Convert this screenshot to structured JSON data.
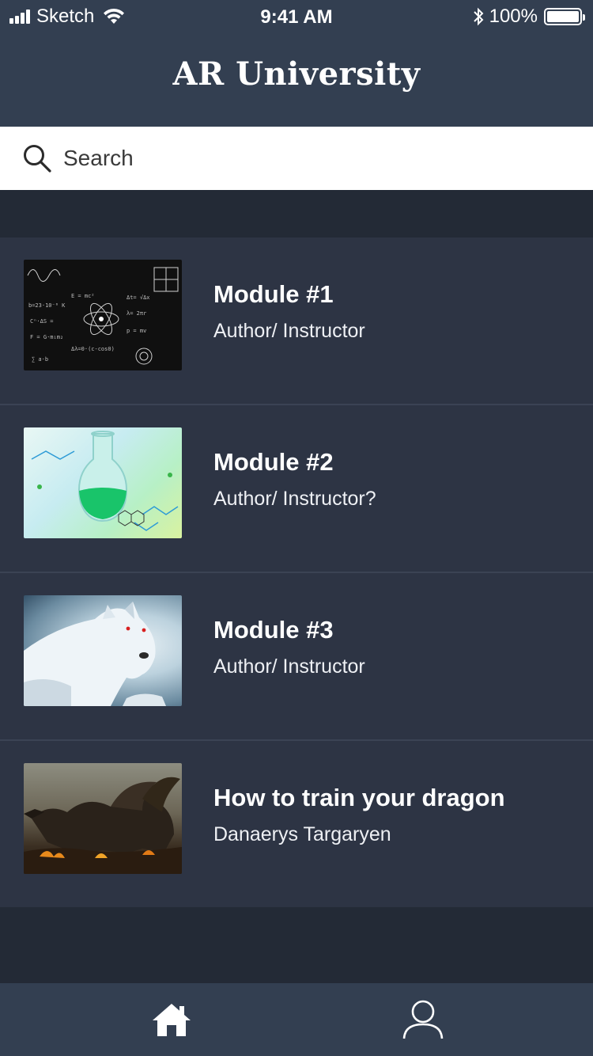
{
  "status_bar": {
    "carrier": "Sketch",
    "time": "9:41 AM",
    "battery_percent": "100%",
    "signal_bars": 4,
    "battery_level": 1.0
  },
  "header": {
    "title": "AR University"
  },
  "search": {
    "placeholder": "Search",
    "icon": "search-icon"
  },
  "modules": [
    {
      "title": "Module #1",
      "author": "Author/ Instructor",
      "thumbnail": "physics-formulas-image"
    },
    {
      "title": "Module #2",
      "author": "Author/ Instructor?",
      "thumbnail": "chemistry-flask-image"
    },
    {
      "title": "Module #3",
      "author": "Author/ Instructor",
      "thumbnail": "white-wolf-image"
    },
    {
      "title": "How to train your dragon",
      "author": "Danaerys Targaryen",
      "thumbnail": "dragon-image"
    }
  ],
  "tab_bar": {
    "tabs": [
      {
        "name": "home",
        "icon": "home-icon"
      },
      {
        "name": "profile",
        "icon": "user-icon"
      }
    ]
  },
  "colors": {
    "header_bg": "#333f51",
    "list_bg": "#2d3444",
    "page_bg": "#232a36",
    "divider": "#3b4354",
    "text": "#ffffff"
  }
}
